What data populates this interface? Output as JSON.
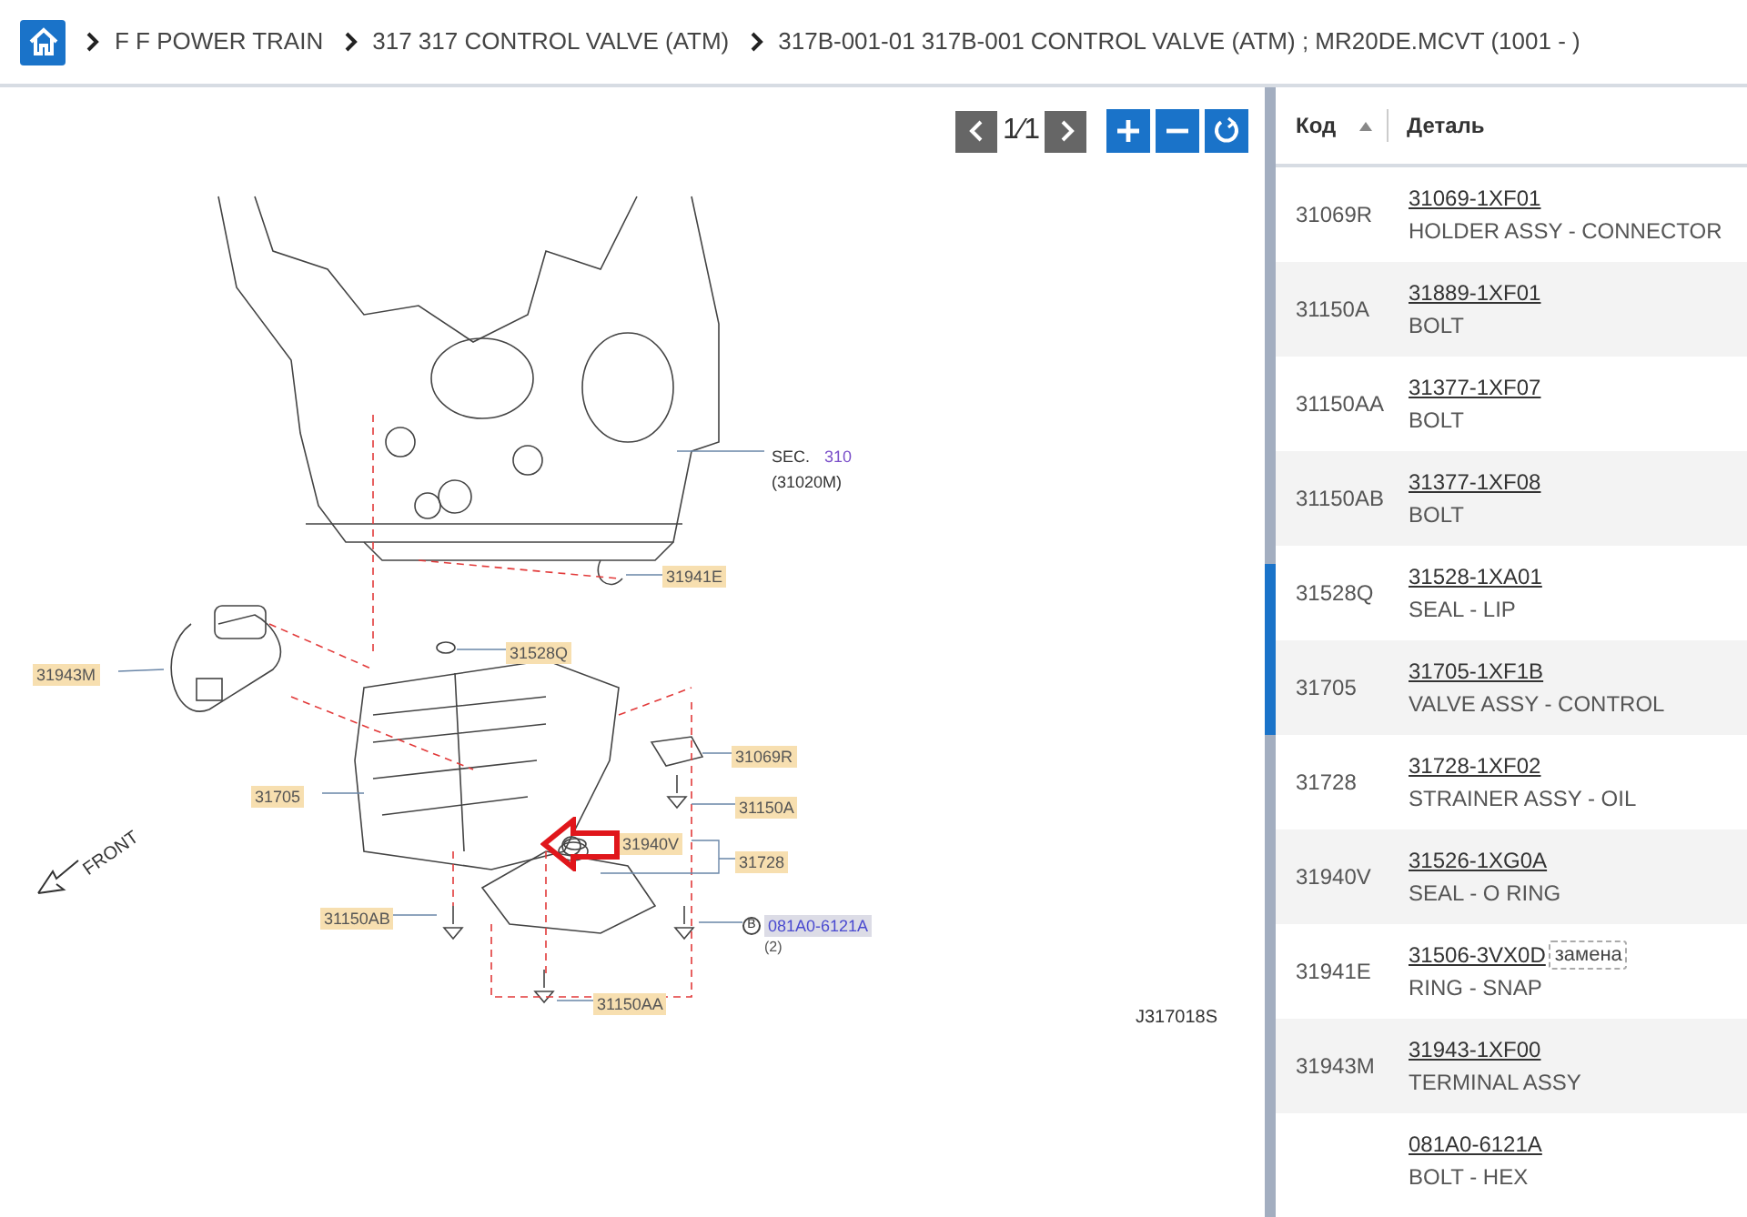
{
  "breadcrumb": [
    "F F POWER TRAIN",
    "317 317 CONTROL VALVE (ATM)",
    "317B-001-01 317B-001 CONTROL VALVE (ATM) ; MR20DE.MCVT (1001 - )"
  ],
  "viewer": {
    "page": "1⁄1"
  },
  "diagram": {
    "callouts": [
      {
        "kind": "sec",
        "text": "SEC.",
        "ref": "310",
        "sub": "(31020M)"
      },
      {
        "kind": "part",
        "text": "31941E"
      },
      {
        "kind": "part",
        "text": "31528Q"
      },
      {
        "kind": "part",
        "text": "31943M"
      },
      {
        "kind": "part",
        "text": "31069R"
      },
      {
        "kind": "part",
        "text": "31705"
      },
      {
        "kind": "part",
        "text": "31150A"
      },
      {
        "kind": "part",
        "text": "31940V"
      },
      {
        "kind": "part",
        "text": "31728"
      },
      {
        "kind": "part",
        "text": "31150AB"
      },
      {
        "kind": "ref",
        "text": "081A0-6121A",
        "badge": "B",
        "sub": "(2)"
      },
      {
        "kind": "part",
        "text": "31150AA"
      },
      {
        "kind": "plain",
        "text": "FRONT"
      },
      {
        "kind": "plain",
        "text": "J317018S"
      }
    ]
  },
  "table": {
    "columns": [
      {
        "label": "Код",
        "sorted": true
      },
      {
        "label": "Деталь"
      }
    ],
    "rows": [
      {
        "code": "31069R",
        "number": "31069-1XF01",
        "name": "HOLDER ASSY - CONNECTOR"
      },
      {
        "code": "31150A",
        "number": "31889-1XF01",
        "name": "BOLT"
      },
      {
        "code": "31150AA",
        "number": "31377-1XF07",
        "name": "BOLT"
      },
      {
        "code": "31150AB",
        "number": "31377-1XF08",
        "name": "BOLT"
      },
      {
        "code": "31528Q",
        "number": "31528-1XA01",
        "name": "SEAL - LIP"
      },
      {
        "code": "31705",
        "number": "31705-1XF1B",
        "name": "VALVE ASSY - CONTROL"
      },
      {
        "code": "31728",
        "number": "31728-1XF02",
        "name": "STRAINER ASSY - OIL"
      },
      {
        "code": "31940V",
        "number": "31526-1XG0A",
        "name": "SEAL - O RING"
      },
      {
        "code": "31941E",
        "number": "31506-3VX0D",
        "tag": "замена",
        "name": "RING - SNAP"
      },
      {
        "code": "31943M",
        "number": "31943-1XF00",
        "name": "TERMINAL ASSY"
      },
      {
        "number": "081A0-6121A",
        "name": "BOLT - HEX"
      }
    ]
  }
}
